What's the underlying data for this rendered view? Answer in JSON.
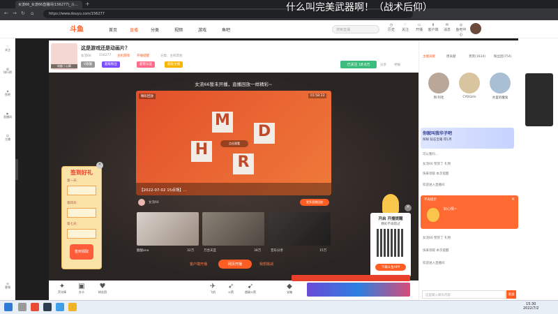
{
  "overlay_text": "什么叫完美武器啊！（战术后仰）",
  "browser": {
    "tab_title": "女流66_女流66直播间(156277)_斗...",
    "url": "https://www.douyu.com/156277"
  },
  "header": {
    "logo": "斗鱼",
    "nav": [
      "首页",
      "直播",
      "分类",
      "视频",
      "游戏",
      "鱼吧"
    ],
    "search_placeholder": "搜索直播",
    "icons": [
      "历史",
      "关注",
      "开播",
      "客户端",
      "消息",
      "鱼吧中心"
    ]
  },
  "sidebar": {
    "items": [
      "关注",
      "排行榜",
      "鱼吧",
      "直播间",
      "主播"
    ],
    "bottom": "客服"
  },
  "room": {
    "avatar_caption": "电脑 | 心情",
    "title": "这是游戏还是动画片？",
    "meta": [
      "女流66",
      "156277",
      "主机游戏",
      "开播提醒",
      "分类：主机其他"
    ],
    "badges": [
      "V旗舰",
      "超级粉丝",
      "超管认证",
      "超级主播"
    ],
    "follow": "已关注 18.6万",
    "right_links": [
      "分享",
      "举报",
      "返回顶部"
    ]
  },
  "player": {
    "offline_msg": "女流66暂未开播，直播回放一样精彩~",
    "duration": "01:58:33",
    "replay_label": "精彩回放",
    "replay_title": "【2022-07-02 15点场】...",
    "author": "女流66",
    "more_btn": "更多直播回放",
    "tiles": [
      "M",
      "D",
      "H",
      "R"
    ],
    "play_label": "点击观看",
    "recommendations": [
      {
        "title": "椅子大主播",
        "views": "32万",
        "author": "酸酸ana"
      },
      {
        "title": "【万合天宜】王大锤",
        "views": "38万",
        "author": "万合天宜"
      },
      {
        "title": "吉他社·丽丽姐",
        "views": "15万",
        "author": "音乐分享"
      }
    ],
    "bottom_links": [
      "客户端开播",
      "网页开播",
      "我想挑战"
    ],
    "open_btn": "网页开播"
  },
  "signin": {
    "title": "签到好礼",
    "days": [
      "第一天:",
      "第四天:",
      "第七天:"
    ],
    "button": "签到领取"
  },
  "qr_card": {
    "title": "开启 开播提醒",
    "subtitle": "精彩不再错过",
    "button": "下载斗鱼APP"
  },
  "gifts": [
    "荧光棒",
    "办卡",
    "粉丝团",
    "飞机",
    "火箭",
    "超级火箭",
    "宝箱"
  ],
  "right_panel": {
    "tabs": [
      "主播贡献",
      "周贡献",
      "贵宾(1634)",
      "粉丝团(754)"
    ],
    "fans": [
      "周·阿毛",
      "CYOGirls",
      "水里的魔鬼"
    ],
    "promo_title": "你就叫我华子吧",
    "promo_sub": "探秘 钻石宝箱 得1月",
    "chat": [
      "可以看吗...",
      "女流66 赞赏了 礼物",
      "快来领取 本次提醒",
      "欢迎进入直播间"
    ],
    "notice_title": "不再提示",
    "notice_text": "好心情~",
    "chat_placeholder": "这里输入聊天内容",
    "send": "发送"
  },
  "taskbar": {
    "time": "15:30",
    "date": "2022/7/2"
  }
}
